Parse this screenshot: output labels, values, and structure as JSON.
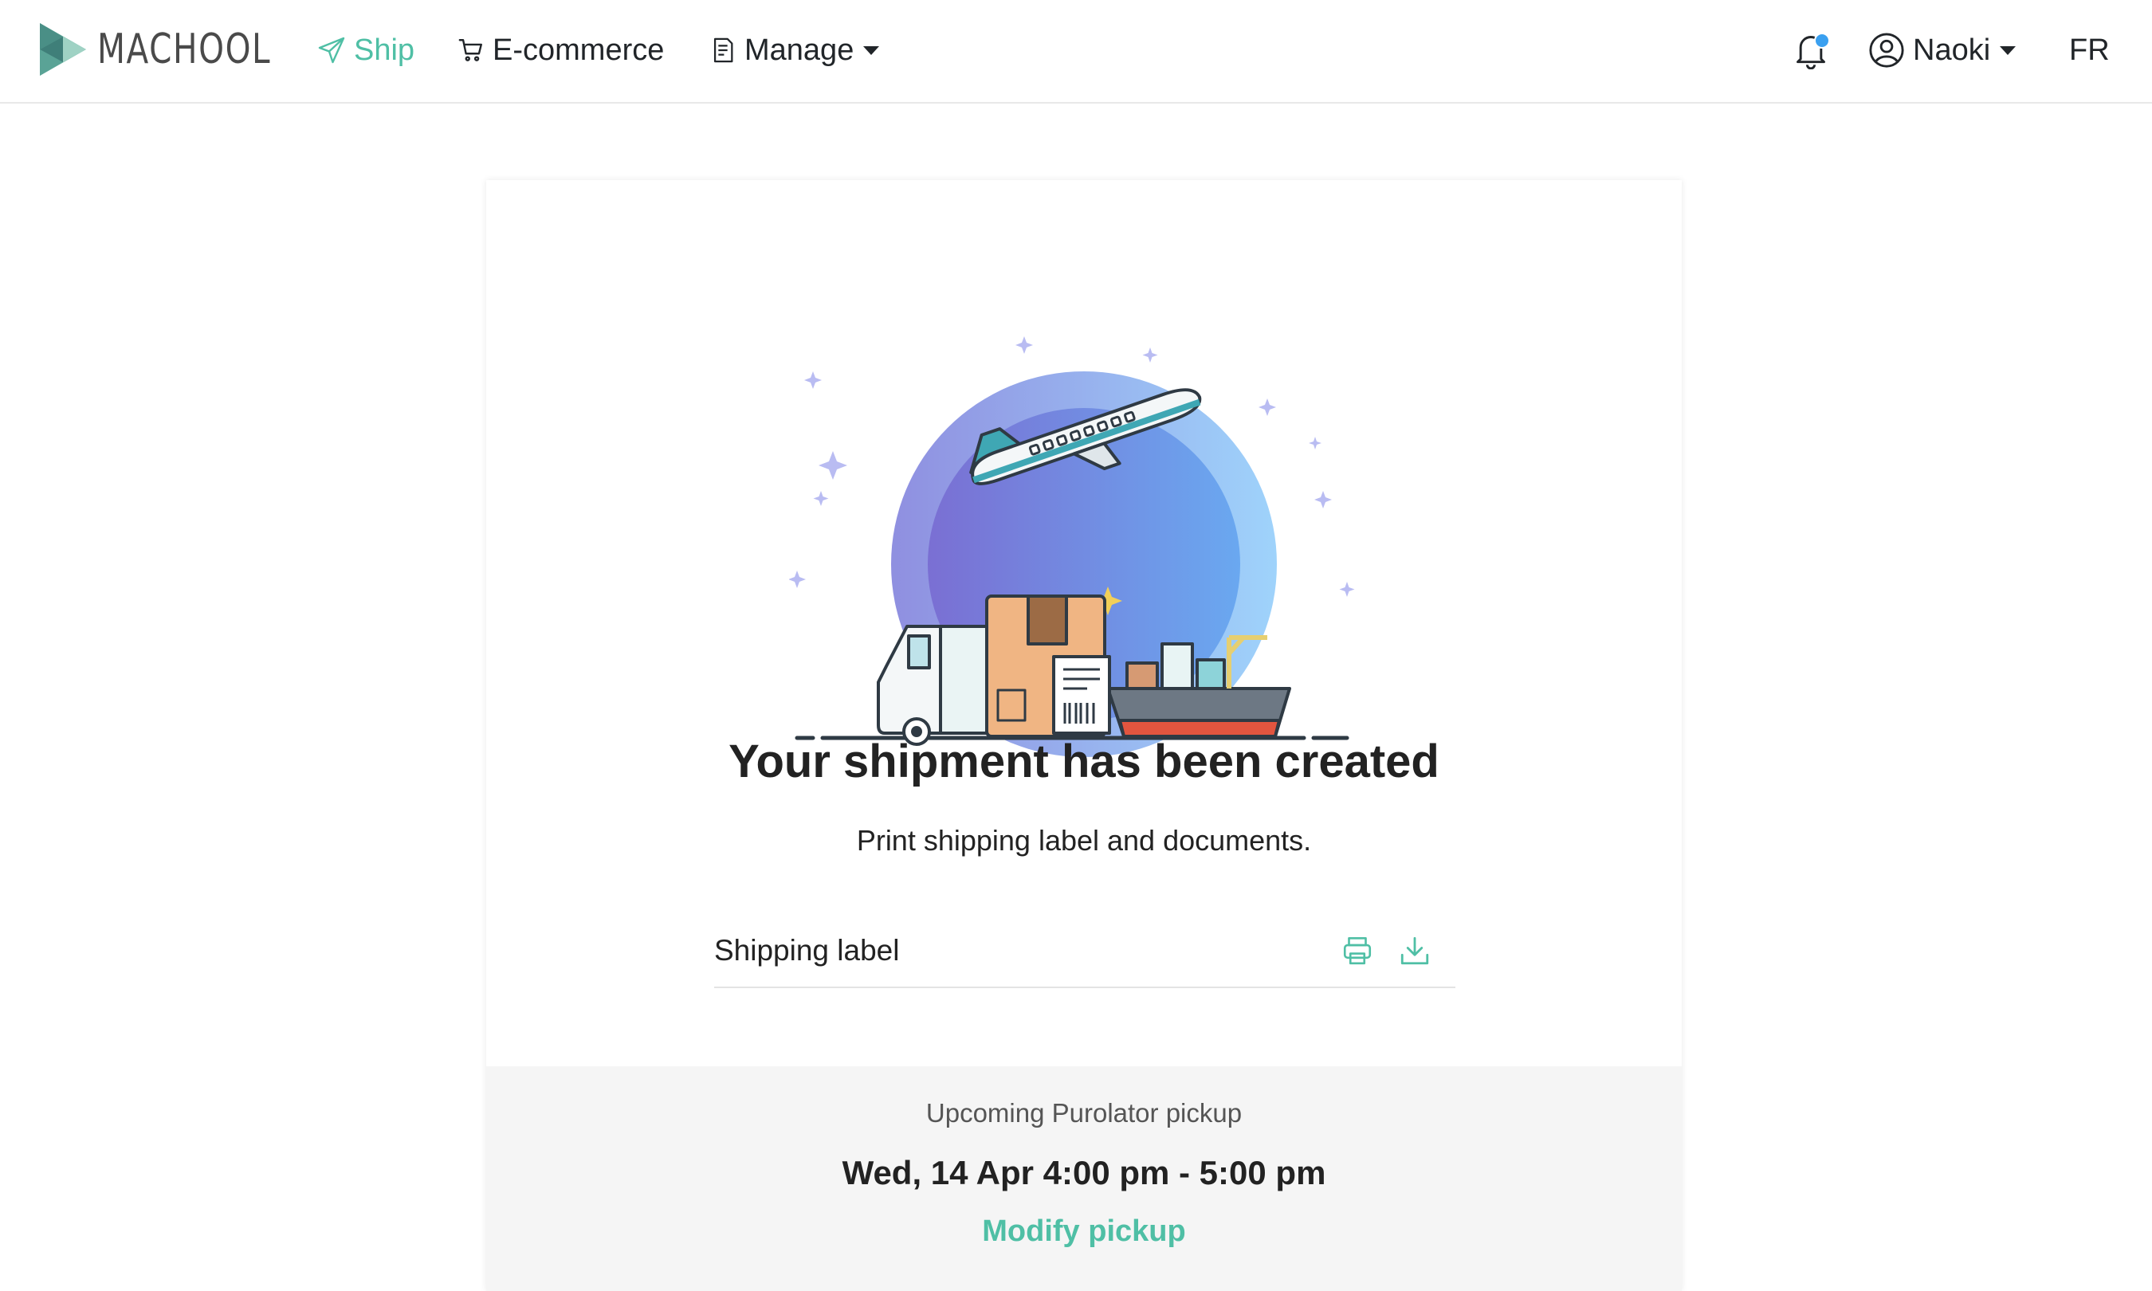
{
  "brand": {
    "name": "MACHOOL"
  },
  "nav": {
    "items": [
      {
        "label": "Ship",
        "icon": "paper-plane-icon",
        "active": true
      },
      {
        "label": "E-commerce",
        "icon": "cart-icon",
        "active": false
      },
      {
        "label": "Manage",
        "icon": "document-icon",
        "active": false,
        "dropdown": true
      }
    ],
    "user": {
      "name": "Naoki"
    },
    "language": "FR",
    "notification_icon": "bell-icon"
  },
  "card": {
    "title": "Your shipment has been created",
    "subtitle": "Print shipping label and documents.",
    "documents": [
      {
        "label": "Shipping label",
        "actions": [
          "printer-icon",
          "download-icon"
        ]
      }
    ],
    "pickup": {
      "caption": "Upcoming Purolator pickup",
      "time": "Wed, 14 Apr 4:00 pm - 5:00 pm",
      "modify_label": "Modify pickup"
    }
  },
  "colors": {
    "accent": "#4fbfa5",
    "notification_dot": "#3aa0f0"
  }
}
